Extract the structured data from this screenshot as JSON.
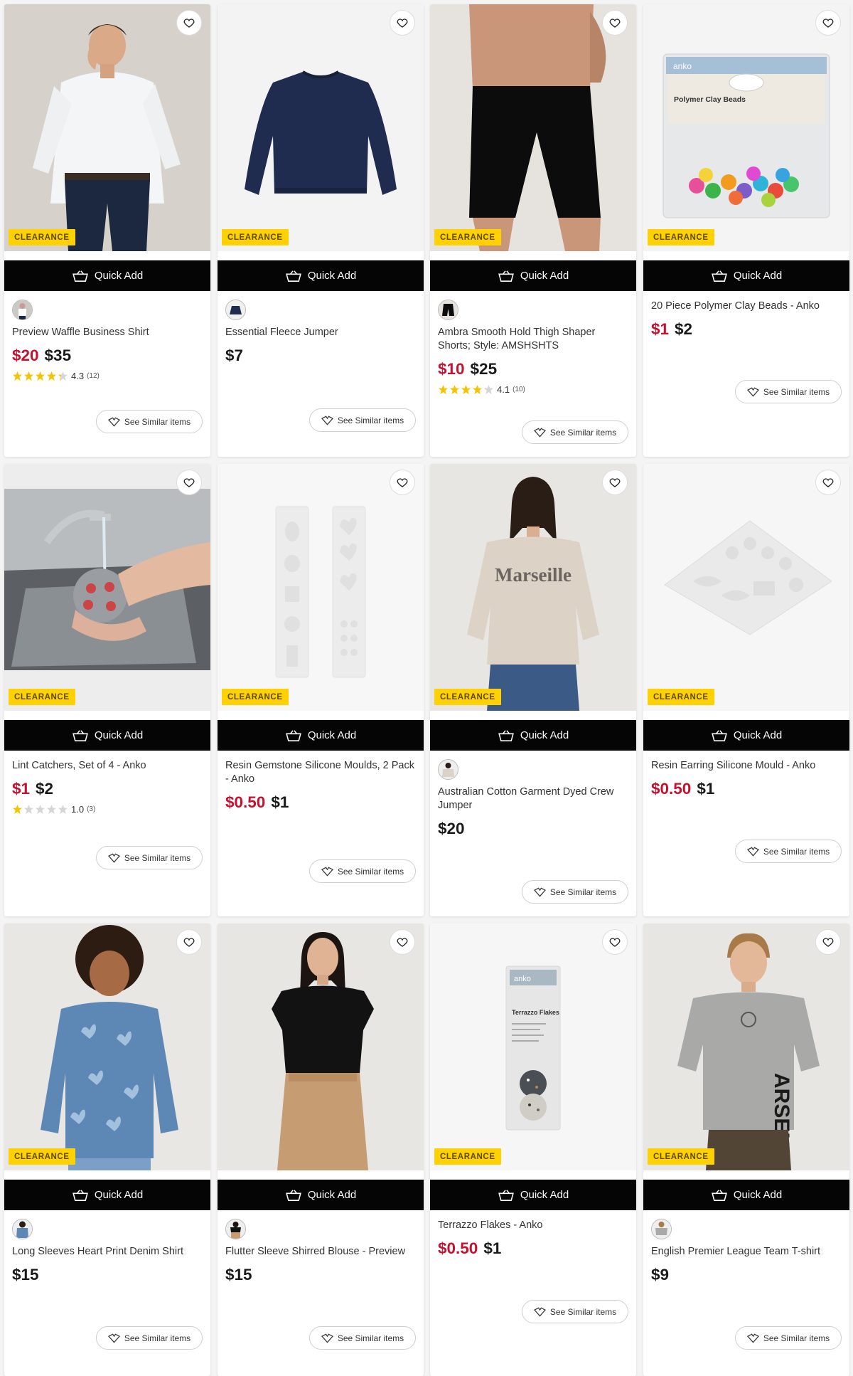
{
  "labels": {
    "badge": "CLEARANCE",
    "quick_add": "Quick Add",
    "see_similar": "See Similar items"
  },
  "colors": {
    "badge_bg": "#ffd100",
    "sale_price": "#c8102e",
    "quick_add_bg": "#050505",
    "star": "#f5c400"
  },
  "products": [
    {
      "name": "Preview Waffle Business Shirt",
      "price_now": "$20",
      "price_was": "$35",
      "on_sale": true,
      "rating": 4.3,
      "rating_text": "4.3",
      "review_count": "(12)",
      "has_swatch": true,
      "clearance": true
    },
    {
      "name": "Essential Fleece Jumper",
      "price_now": "$7",
      "on_sale": false,
      "has_swatch": true,
      "clearance": true
    },
    {
      "name": "Ambra Smooth Hold Thigh Shaper Shorts; Style: AMSHSHTS",
      "price_now": "$10",
      "price_was": "$25",
      "on_sale": true,
      "rating": 4.1,
      "rating_text": "4.1",
      "review_count": "(10)",
      "has_swatch": true,
      "clearance": true
    },
    {
      "name": "20 Piece Polymer Clay Beads - Anko",
      "price_now": "$1",
      "price_was": "$2",
      "on_sale": true,
      "has_swatch": false,
      "clearance": true,
      "packaging_text": [
        "anko",
        "Polymer Clay Beads"
      ]
    },
    {
      "name": "Lint Catchers, Set of 4 - Anko",
      "price_now": "$1",
      "price_was": "$2",
      "on_sale": true,
      "rating": 1.0,
      "rating_text": "1.0",
      "review_count": "(3)",
      "has_swatch": false,
      "clearance": true
    },
    {
      "name": "Resin Gemstone Silicone Moulds, 2 Pack - Anko",
      "price_now": "$0.50",
      "price_was": "$1",
      "on_sale": true,
      "has_swatch": false,
      "clearance": true
    },
    {
      "name": "Australian Cotton Garment Dyed Crew Jumper",
      "price_now": "$20",
      "on_sale": false,
      "has_swatch": true,
      "clearance": true,
      "print_text": "Marseille"
    },
    {
      "name": "Resin Earring Silicone Mould - Anko",
      "price_now": "$0.50",
      "price_was": "$1",
      "on_sale": true,
      "has_swatch": false,
      "clearance": true
    },
    {
      "name": "Long Sleeves Heart Print Denim Shirt",
      "price_now": "$15",
      "on_sale": false,
      "has_swatch": true,
      "clearance": true
    },
    {
      "name": "Flutter Sleeve Shirred Blouse - Preview",
      "price_now": "$15",
      "on_sale": false,
      "has_swatch": true,
      "clearance": false
    },
    {
      "name": "Terrazzo Flakes - Anko",
      "price_now": "$0.50",
      "price_was": "$1",
      "on_sale": true,
      "has_swatch": false,
      "clearance": true,
      "packaging_text": [
        "anko",
        "Terrazzo Flakes"
      ]
    },
    {
      "name": "English Premier League Team T-shirt",
      "price_now": "$9",
      "on_sale": false,
      "has_swatch": true,
      "clearance": true,
      "print_text": "ARSENAL"
    }
  ]
}
